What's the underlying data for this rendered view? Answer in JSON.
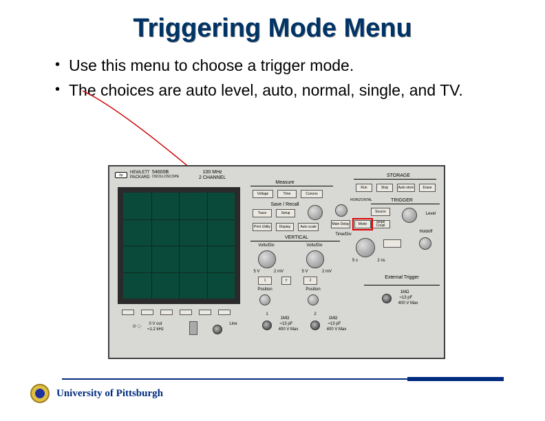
{
  "title": "Triggering Mode Menu",
  "bullets": [
    "Use this menu to choose a trigger mode.",
    "The choices are auto level, auto, normal, single, and TV."
  ],
  "footer": {
    "university": "University of Pittsburgh"
  },
  "scope": {
    "hp": "hp",
    "brand_line1": "HEWLETT",
    "brand_line2": "PACKARD",
    "model": "54600B",
    "model_sub": "OSCILLOSCOPE",
    "spec_line1": "100 MHz",
    "spec_line2": "2  CHANNEL",
    "sections": {
      "storage": "STORAGE",
      "trigger": "TRIGGER",
      "measure": "Measure",
      "saverecall": "Save / Recall",
      "timediv": "Time/Div",
      "horizontal": "HORIZONTAL",
      "vertical": "VERTICAL",
      "holdoff": "Holdoff",
      "level": "Level",
      "external": "External Trigger"
    },
    "buttons": {
      "run": "Run",
      "stop": "Stop",
      "auto": "Auto store",
      "erase": "Erase",
      "voltage": "Voltage",
      "time": "Time",
      "cursors": "Cursors",
      "trace": "Trace",
      "setup": "Setup",
      "print": "Print Utility",
      "display": "Display",
      "auto2": "Auto scale",
      "source": "Source",
      "mode": "Mode",
      "slope": "Slope Coupl",
      "main": "Main Delay"
    },
    "vertical": {
      "voltsdiv1": "Volts/Div",
      "voltsdiv2": "Volts/Div",
      "ch1": "1",
      "ch2": "2",
      "pm": "±",
      "pos": "Position",
      "scale_l": "5 V",
      "scale_r": "2 mV",
      "scale_l2": "5 V",
      "scale_r2": "2 mV",
      "td_l": "5 s",
      "td_r": "2 ns"
    },
    "bottom": {
      "ch1": "1",
      "ch2": "2",
      "imp1": "1MΩ",
      "imp2": "≈13 pF",
      "imp3": "400 V Max",
      "line": "Line",
      "freq": "≈1.2 kHz",
      "vout": "0 V out",
      "sym": "⏻ ◇"
    }
  }
}
